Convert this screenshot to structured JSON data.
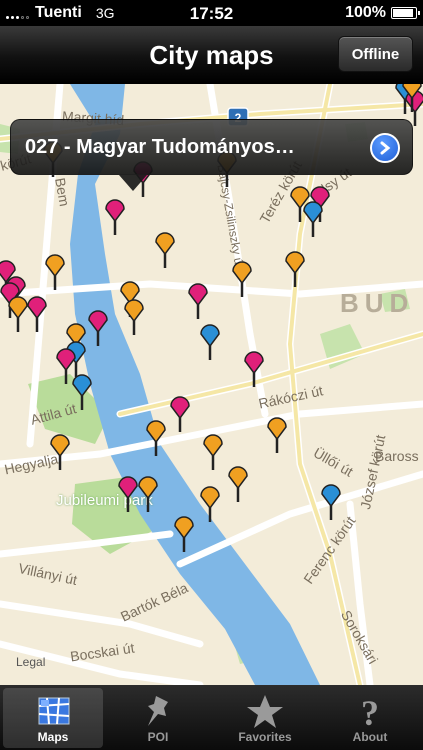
{
  "status_bar": {
    "carrier": "Tuenti",
    "network": "3G",
    "time": "17:52",
    "battery": "100%"
  },
  "nav": {
    "title": "City maps",
    "offline_label": "Offline"
  },
  "map": {
    "street_labels": [
      "Margit híd",
      "Bem",
      "Bajcsy-Zsilinszky út",
      "Teréz körút",
      "Attila út",
      "Hegyalja",
      "Rákóczi út",
      "Üllői út",
      "József körút",
      "Jubileumi park",
      "Bartók Béla",
      "Villányi út",
      "Bocskai út",
      "Ferenc körút",
      "Soroksári",
      "Baross",
      "BUD",
      "2",
      "körút",
      "lsy út"
    ],
    "legal": "Legal",
    "pin_colors": {
      "orange": "#f0a021",
      "pink": "#e0207a",
      "blue": "#2a8fd6"
    }
  },
  "callout": {
    "text": "027 - Magyar Tudományos…"
  },
  "tabs": [
    {
      "label": "Maps",
      "icon": "map-icon",
      "selected": true
    },
    {
      "label": "POI",
      "icon": "pushpin-icon",
      "selected": false
    },
    {
      "label": "Favorites",
      "icon": "star-icon",
      "selected": false
    },
    {
      "label": "About",
      "icon": "question-icon",
      "selected": false
    }
  ]
}
